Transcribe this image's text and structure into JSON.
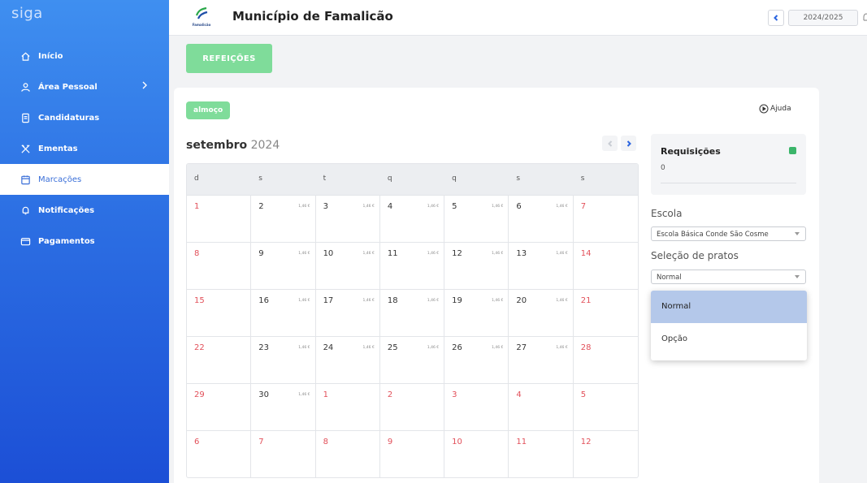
{
  "app": {
    "brand": "siga"
  },
  "sidebar": {
    "items": [
      {
        "label": "Início",
        "icon": "home-icon"
      },
      {
        "label": "Área Pessoal",
        "icon": "user-icon"
      },
      {
        "label": "Candidaturas",
        "icon": "document-icon"
      },
      {
        "label": "Ementas",
        "icon": "utensils-icon"
      },
      {
        "label": "Marcações",
        "icon": "calendar-icon"
      },
      {
        "label": "Notificações",
        "icon": "bell-icon"
      },
      {
        "label": "Pagamentos",
        "icon": "wallet-icon"
      }
    ],
    "active": "Marcações"
  },
  "header": {
    "logo_text": "Famalicão",
    "title": "Município de Famalicão",
    "school_year": "2024/2025"
  },
  "meals_button": "REFEIÇÕES",
  "meal_tag": "almoço",
  "help_label": "Ajuda",
  "calendar": {
    "month": "setembro",
    "year": "2024",
    "weekdays": [
      "d",
      "s",
      "t",
      "q",
      "q",
      "s",
      "s"
    ],
    "price": "1,46 €",
    "weeks": [
      [
        "1",
        "2",
        "3",
        "4",
        "5",
        "6",
        "7"
      ],
      [
        "8",
        "9",
        "10",
        "11",
        "12",
        "13",
        "14"
      ],
      [
        "15",
        "16",
        "17",
        "18",
        "19",
        "20",
        "21"
      ],
      [
        "22",
        "23",
        "24",
        "25",
        "26",
        "27",
        "28"
      ],
      [
        "29",
        "30",
        "1",
        "2",
        "3",
        "4",
        "5"
      ],
      [
        "6",
        "7",
        "8",
        "9",
        "10",
        "11",
        "12"
      ]
    ]
  },
  "requests": {
    "title": "Requisições",
    "value": "0",
    "status_color": "#3bb56a"
  },
  "school": {
    "label": "Escola",
    "value": "Escola Básica Conde São Cosme"
  },
  "dish": {
    "label": "Seleção de pratos",
    "value": "Normal",
    "options": [
      "Normal",
      "Opção"
    ]
  },
  "colors": {
    "accent": "#2b65e0",
    "green": "#7fdc9a",
    "weekend_red": "#e2505a"
  }
}
